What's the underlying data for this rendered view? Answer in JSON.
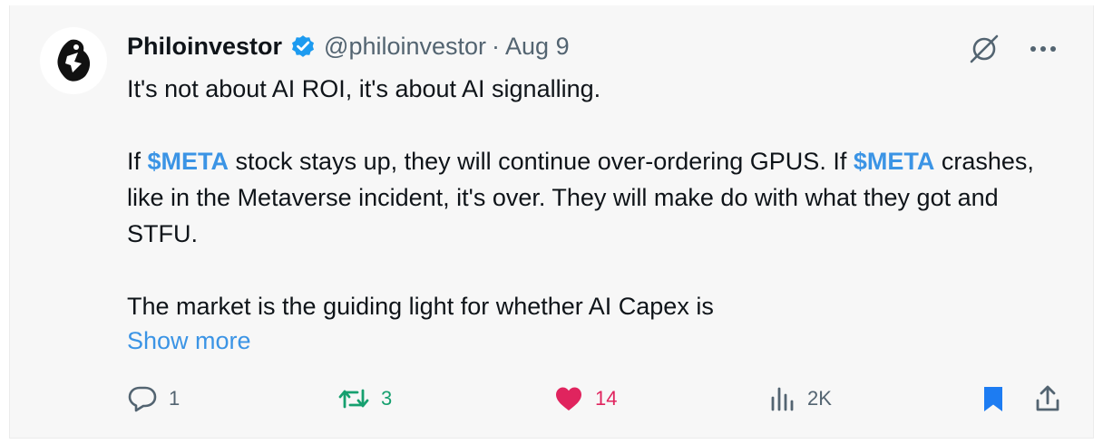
{
  "post": {
    "author": {
      "name": "Philoinvestor",
      "handle": "@philoinvestor",
      "verified": true,
      "avatar_icon": "abstract-figure-logo"
    },
    "separator": "·",
    "date": "Aug 9",
    "text": {
      "line1": "It's not about AI ROI, it's about AI signalling.",
      "para2_part1": "If ",
      "cashtag1": "$META",
      "para2_part2": " stock stays up, they will continue over-ordering GPUS. If ",
      "cashtag2": "$META",
      "para2_part3": " crashes, like in the Metaverse incident, it's over. They will make do with what they got and STFU.",
      "para3": "The market is the guiding light for whether AI Capex is"
    },
    "show_more": "Show more",
    "stats": {
      "replies": "1",
      "reposts": "3",
      "likes": "14",
      "views": "2K"
    },
    "colors": {
      "accent": "#3b94e5",
      "repost_active": "#16a06f",
      "like_active": "#e0245e",
      "muted": "#536471"
    },
    "icons": {
      "top": [
        "grok-icon",
        "more-icon"
      ],
      "actions": [
        "reply-icon",
        "repost-icon",
        "like-icon",
        "views-icon",
        "bookmark-icon",
        "share-icon"
      ]
    }
  }
}
